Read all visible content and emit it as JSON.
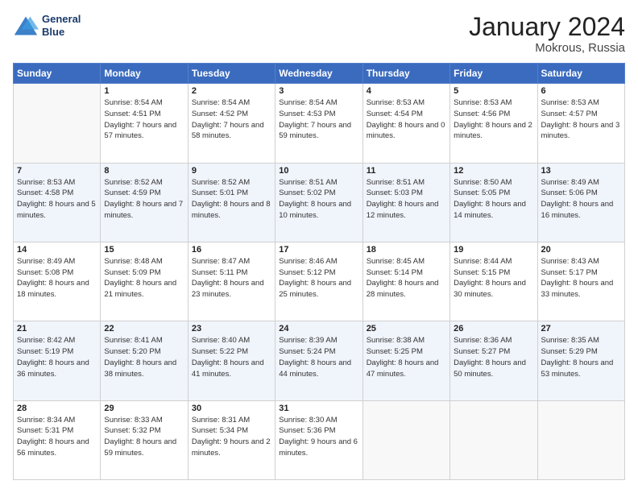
{
  "header": {
    "logo_line1": "General",
    "logo_line2": "Blue",
    "title": "January 2024",
    "subtitle": "Mokrous, Russia"
  },
  "days_of_week": [
    "Sunday",
    "Monday",
    "Tuesday",
    "Wednesday",
    "Thursday",
    "Friday",
    "Saturday"
  ],
  "weeks": [
    [
      {
        "day": "",
        "sunrise": "",
        "sunset": "",
        "daylight": ""
      },
      {
        "day": "1",
        "sunrise": "Sunrise: 8:54 AM",
        "sunset": "Sunset: 4:51 PM",
        "daylight": "Daylight: 7 hours and 57 minutes."
      },
      {
        "day": "2",
        "sunrise": "Sunrise: 8:54 AM",
        "sunset": "Sunset: 4:52 PM",
        "daylight": "Daylight: 7 hours and 58 minutes."
      },
      {
        "day": "3",
        "sunrise": "Sunrise: 8:54 AM",
        "sunset": "Sunset: 4:53 PM",
        "daylight": "Daylight: 7 hours and 59 minutes."
      },
      {
        "day": "4",
        "sunrise": "Sunrise: 8:53 AM",
        "sunset": "Sunset: 4:54 PM",
        "daylight": "Daylight: 8 hours and 0 minutes."
      },
      {
        "day": "5",
        "sunrise": "Sunrise: 8:53 AM",
        "sunset": "Sunset: 4:56 PM",
        "daylight": "Daylight: 8 hours and 2 minutes."
      },
      {
        "day": "6",
        "sunrise": "Sunrise: 8:53 AM",
        "sunset": "Sunset: 4:57 PM",
        "daylight": "Daylight: 8 hours and 3 minutes."
      }
    ],
    [
      {
        "day": "7",
        "sunrise": "Sunrise: 8:53 AM",
        "sunset": "Sunset: 4:58 PM",
        "daylight": "Daylight: 8 hours and 5 minutes."
      },
      {
        "day": "8",
        "sunrise": "Sunrise: 8:52 AM",
        "sunset": "Sunset: 4:59 PM",
        "daylight": "Daylight: 8 hours and 7 minutes."
      },
      {
        "day": "9",
        "sunrise": "Sunrise: 8:52 AM",
        "sunset": "Sunset: 5:01 PM",
        "daylight": "Daylight: 8 hours and 8 minutes."
      },
      {
        "day": "10",
        "sunrise": "Sunrise: 8:51 AM",
        "sunset": "Sunset: 5:02 PM",
        "daylight": "Daylight: 8 hours and 10 minutes."
      },
      {
        "day": "11",
        "sunrise": "Sunrise: 8:51 AM",
        "sunset": "Sunset: 5:03 PM",
        "daylight": "Daylight: 8 hours and 12 minutes."
      },
      {
        "day": "12",
        "sunrise": "Sunrise: 8:50 AM",
        "sunset": "Sunset: 5:05 PM",
        "daylight": "Daylight: 8 hours and 14 minutes."
      },
      {
        "day": "13",
        "sunrise": "Sunrise: 8:49 AM",
        "sunset": "Sunset: 5:06 PM",
        "daylight": "Daylight: 8 hours and 16 minutes."
      }
    ],
    [
      {
        "day": "14",
        "sunrise": "Sunrise: 8:49 AM",
        "sunset": "Sunset: 5:08 PM",
        "daylight": "Daylight: 8 hours and 18 minutes."
      },
      {
        "day": "15",
        "sunrise": "Sunrise: 8:48 AM",
        "sunset": "Sunset: 5:09 PM",
        "daylight": "Daylight: 8 hours and 21 minutes."
      },
      {
        "day": "16",
        "sunrise": "Sunrise: 8:47 AM",
        "sunset": "Sunset: 5:11 PM",
        "daylight": "Daylight: 8 hours and 23 minutes."
      },
      {
        "day": "17",
        "sunrise": "Sunrise: 8:46 AM",
        "sunset": "Sunset: 5:12 PM",
        "daylight": "Daylight: 8 hours and 25 minutes."
      },
      {
        "day": "18",
        "sunrise": "Sunrise: 8:45 AM",
        "sunset": "Sunset: 5:14 PM",
        "daylight": "Daylight: 8 hours and 28 minutes."
      },
      {
        "day": "19",
        "sunrise": "Sunrise: 8:44 AM",
        "sunset": "Sunset: 5:15 PM",
        "daylight": "Daylight: 8 hours and 30 minutes."
      },
      {
        "day": "20",
        "sunrise": "Sunrise: 8:43 AM",
        "sunset": "Sunset: 5:17 PM",
        "daylight": "Daylight: 8 hours and 33 minutes."
      }
    ],
    [
      {
        "day": "21",
        "sunrise": "Sunrise: 8:42 AM",
        "sunset": "Sunset: 5:19 PM",
        "daylight": "Daylight: 8 hours and 36 minutes."
      },
      {
        "day": "22",
        "sunrise": "Sunrise: 8:41 AM",
        "sunset": "Sunset: 5:20 PM",
        "daylight": "Daylight: 8 hours and 38 minutes."
      },
      {
        "day": "23",
        "sunrise": "Sunrise: 8:40 AM",
        "sunset": "Sunset: 5:22 PM",
        "daylight": "Daylight: 8 hours and 41 minutes."
      },
      {
        "day": "24",
        "sunrise": "Sunrise: 8:39 AM",
        "sunset": "Sunset: 5:24 PM",
        "daylight": "Daylight: 8 hours and 44 minutes."
      },
      {
        "day": "25",
        "sunrise": "Sunrise: 8:38 AM",
        "sunset": "Sunset: 5:25 PM",
        "daylight": "Daylight: 8 hours and 47 minutes."
      },
      {
        "day": "26",
        "sunrise": "Sunrise: 8:36 AM",
        "sunset": "Sunset: 5:27 PM",
        "daylight": "Daylight: 8 hours and 50 minutes."
      },
      {
        "day": "27",
        "sunrise": "Sunrise: 8:35 AM",
        "sunset": "Sunset: 5:29 PM",
        "daylight": "Daylight: 8 hours and 53 minutes."
      }
    ],
    [
      {
        "day": "28",
        "sunrise": "Sunrise: 8:34 AM",
        "sunset": "Sunset: 5:31 PM",
        "daylight": "Daylight: 8 hours and 56 minutes."
      },
      {
        "day": "29",
        "sunrise": "Sunrise: 8:33 AM",
        "sunset": "Sunset: 5:32 PM",
        "daylight": "Daylight: 8 hours and 59 minutes."
      },
      {
        "day": "30",
        "sunrise": "Sunrise: 8:31 AM",
        "sunset": "Sunset: 5:34 PM",
        "daylight": "Daylight: 9 hours and 2 minutes."
      },
      {
        "day": "31",
        "sunrise": "Sunrise: 8:30 AM",
        "sunset": "Sunset: 5:36 PM",
        "daylight": "Daylight: 9 hours and 6 minutes."
      },
      {
        "day": "",
        "sunrise": "",
        "sunset": "",
        "daylight": ""
      },
      {
        "day": "",
        "sunrise": "",
        "sunset": "",
        "daylight": ""
      },
      {
        "day": "",
        "sunrise": "",
        "sunset": "",
        "daylight": ""
      }
    ]
  ]
}
